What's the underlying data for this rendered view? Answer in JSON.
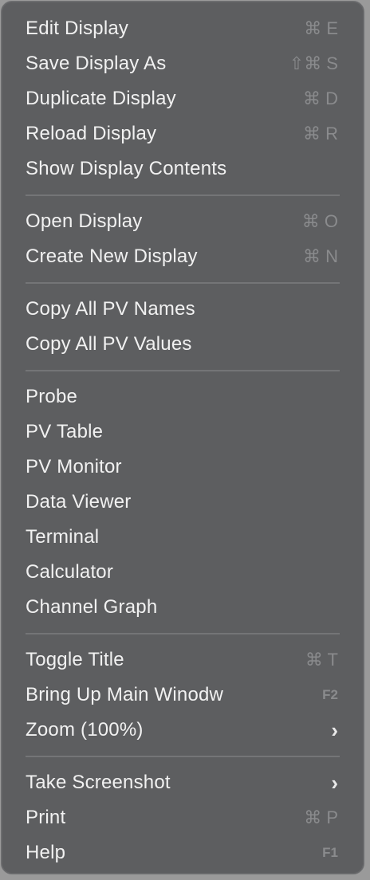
{
  "menu": {
    "groups": [
      {
        "items": [
          {
            "label": "Edit Display",
            "shortcut": "⌘ E"
          },
          {
            "label": "Save Display As",
            "shortcut": "⇧⌘ S"
          },
          {
            "label": "Duplicate Display",
            "shortcut": "⌘ D"
          },
          {
            "label": "Reload Display",
            "shortcut": "⌘ R"
          },
          {
            "label": "Show Display Contents",
            "shortcut": ""
          }
        ]
      },
      {
        "items": [
          {
            "label": "Open Display",
            "shortcut": "⌘ O"
          },
          {
            "label": "Create New Display",
            "shortcut": "⌘ N"
          }
        ]
      },
      {
        "items": [
          {
            "label": "Copy All PV Names",
            "shortcut": ""
          },
          {
            "label": "Copy All PV Values",
            "shortcut": ""
          }
        ]
      },
      {
        "items": [
          {
            "label": "Probe",
            "shortcut": ""
          },
          {
            "label": "PV Table",
            "shortcut": ""
          },
          {
            "label": "PV Monitor",
            "shortcut": ""
          },
          {
            "label": "Data Viewer",
            "shortcut": ""
          },
          {
            "label": "Terminal",
            "shortcut": ""
          },
          {
            "label": "Calculator",
            "shortcut": ""
          },
          {
            "label": "Channel Graph",
            "shortcut": ""
          }
        ]
      },
      {
        "items": [
          {
            "label": "Toggle Title",
            "shortcut": "⌘ T"
          },
          {
            "label": "Bring Up Main Winodw",
            "shortcut": "F2"
          },
          {
            "label": "Zoom (100%)",
            "submenu_arrow": "›"
          }
        ]
      },
      {
        "items": [
          {
            "label": "Take Screenshot",
            "submenu_arrow": "›"
          },
          {
            "label": "Print",
            "shortcut": "⌘ P"
          },
          {
            "label": "Help",
            "shortcut": "F1"
          }
        ]
      }
    ]
  },
  "colors": {
    "menu_background": "#5d5e60",
    "label_text": "#f1f1f1",
    "shortcut_text": "#8a8b8d",
    "separator": "#747577"
  }
}
